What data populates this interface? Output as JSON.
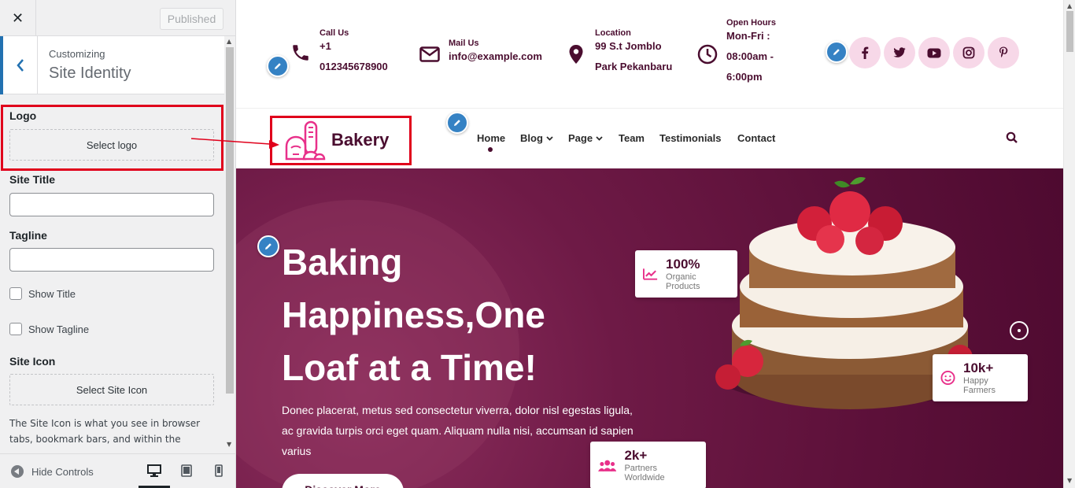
{
  "customizer": {
    "close_icon": "close-icon",
    "publish_label": "Published",
    "breadcrumb": "Customizing",
    "section_title": "Site Identity",
    "logo": {
      "label": "Logo",
      "button": "Select logo"
    },
    "site_title": {
      "label": "Site Title",
      "value": ""
    },
    "tagline": {
      "label": "Tagline",
      "value": ""
    },
    "show_title": "Show Title",
    "show_tagline": "Show Tagline",
    "site_icon": {
      "label": "Site Icon",
      "button": "Select Site Icon"
    },
    "site_icon_desc": "The Site Icon is what you see in browser tabs, bookmark bars, and within the",
    "footer": {
      "hide_controls": "Hide Controls"
    },
    "annotation_color": "#e0001b"
  },
  "site": {
    "contact": [
      {
        "icon": "phone-icon",
        "label": "Call Us",
        "lines": [
          "+1",
          "012345678900"
        ]
      },
      {
        "icon": "mail-icon",
        "label": "Mail Us",
        "lines": [
          "info@example.com"
        ]
      },
      {
        "icon": "location-pin-icon",
        "label": "Location",
        "lines": [
          "99 S.t Jomblo",
          "Park Pekanbaru"
        ]
      },
      {
        "icon": "clock-icon",
        "label": "Open Hours",
        "lines": [
          "Mon-Fri :",
          "08:00am -",
          "6:00pm"
        ]
      }
    ],
    "social": [
      "facebook-icon",
      "twitter-icon",
      "youtube-icon",
      "instagram-icon",
      "pinterest-icon"
    ],
    "logo_text": "Bakery",
    "nav": [
      "Home",
      "Blog",
      "Page",
      "Team",
      "Testimonials",
      "Contact"
    ],
    "hero": {
      "title": "Baking Happiness,One Loaf at a Time!",
      "desc": "Donec placerat, metus sed consectetur viverra, dolor nisl egestas ligula, ac gravida turpis orci eget quam. Aliquam nulla nisi, accumsan id sapien varius",
      "button": "Discover More",
      "stats": [
        {
          "icon": "trend-icon",
          "num": "100%",
          "cap": "Organic Products"
        },
        {
          "icon": "smile-icon",
          "num": "10k+",
          "cap": "Happy Farmers"
        },
        {
          "icon": "users-icon",
          "num": "2k+",
          "cap": "Partners Worldwide"
        }
      ]
    },
    "brand_color": "#4a0d2f",
    "accent_color": "#e8308a"
  }
}
